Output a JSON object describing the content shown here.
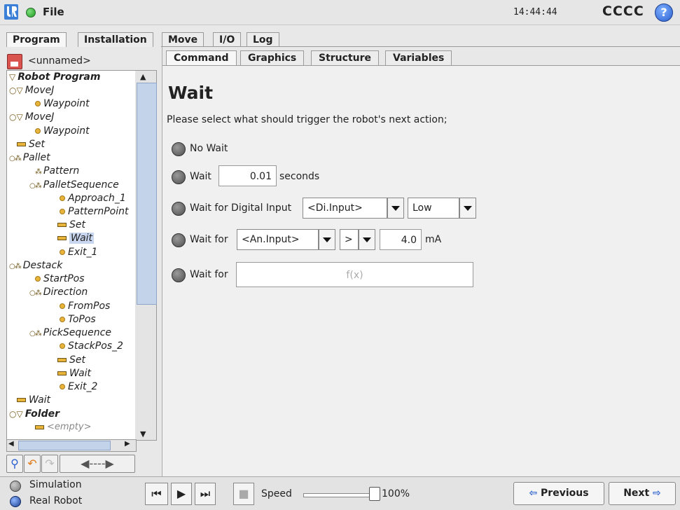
{
  "header": {
    "file_label": "File",
    "clock": "14:44:44",
    "robot_name": "CCCC",
    "help_glyph": "?"
  },
  "main_tabs": [
    {
      "label": "Program",
      "active": true
    },
    {
      "label": "Installation",
      "active": false
    },
    {
      "label": "Move",
      "active": false
    },
    {
      "label": "I/O",
      "active": false
    },
    {
      "label": "Log",
      "active": false
    }
  ],
  "program": {
    "name": "<unnamed>",
    "tree": [
      {
        "label": "Robot Program"
      },
      {
        "label": "MoveJ"
      },
      {
        "label": "Waypoint"
      },
      {
        "label": "MoveJ"
      },
      {
        "label": "Waypoint"
      },
      {
        "label": "Set"
      },
      {
        "label": "Pallet"
      },
      {
        "label": "Pattern"
      },
      {
        "label": "PalletSequence"
      },
      {
        "label": "Approach_1"
      },
      {
        "label": "PatternPoint"
      },
      {
        "label": "Set"
      },
      {
        "label": "Wait"
      },
      {
        "label": "Exit_1"
      },
      {
        "label": "Destack"
      },
      {
        "label": "StartPos"
      },
      {
        "label": "Direction"
      },
      {
        "label": "FromPos"
      },
      {
        "label": "ToPos"
      },
      {
        "label": "PickSequence"
      },
      {
        "label": "StackPos_2"
      },
      {
        "label": "Set"
      },
      {
        "label": "Wait"
      },
      {
        "label": "Exit_2"
      },
      {
        "label": "Wait"
      },
      {
        "label": "Folder"
      },
      {
        "label": "<empty>"
      }
    ],
    "selected_node": "Wait"
  },
  "sub_tabs": [
    {
      "label": "Command",
      "active": true
    },
    {
      "label": "Graphics",
      "active": false
    },
    {
      "label": "Structure",
      "active": false
    },
    {
      "label": "Variables",
      "active": false
    }
  ],
  "wait_panel": {
    "title": "Wait",
    "prompt": "Please select what should trigger the robot's next action;",
    "opt_no_wait": "No Wait",
    "opt_wait": "Wait",
    "wait_seconds_value": "0.01",
    "seconds_unit": "seconds",
    "opt_digital": "Wait for Digital Input",
    "digital_input_select": "<Di.Input>",
    "digital_level_select": "Low",
    "opt_analog": "Wait for",
    "analog_input_select": "<An.Input>",
    "analog_operator_select": ">",
    "analog_value": "4.0",
    "analog_unit": "mA",
    "opt_expression": "Wait for",
    "expression_placeholder": "f(x)"
  },
  "footer": {
    "simulation_label": "Simulation",
    "real_robot_label": "Real Robot",
    "speed_label": "Speed",
    "speed_value": "100%",
    "speed_fraction": 1.0,
    "previous_label": "Previous",
    "next_label": "Next"
  },
  "colors": {
    "accent_blue": "#2a5fd0",
    "node_yellow": "#e8b43a",
    "status_green": "#1f9a1f"
  }
}
